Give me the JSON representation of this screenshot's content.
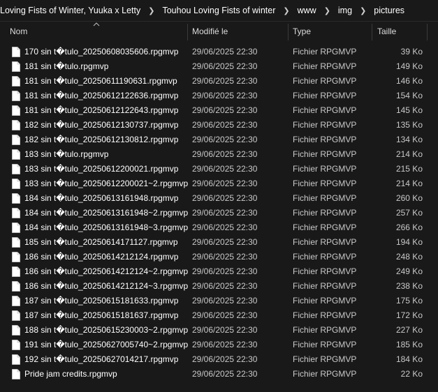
{
  "breadcrumb": [
    "Loving Fists of Winter, Yuuka x Letty",
    "Touhou Loving Fists of winter",
    "www",
    "img",
    "pictures"
  ],
  "columns": {
    "name": "Nom",
    "modified": "Modifié le",
    "type": "Type",
    "size": "Taille"
  },
  "files": [
    {
      "name": "170 sin t�tulo_20250608035606.rpgmvp",
      "modified": "29/06/2025 22:30",
      "type": "Fichier RPGMVP",
      "size": "39 Ko"
    },
    {
      "name": "181 sin t�tulo.rpgmvp",
      "modified": "29/06/2025 22:30",
      "type": "Fichier RPGMVP",
      "size": "149 Ko"
    },
    {
      "name": "181 sin t�tulo_20250611190631.rpgmvp",
      "modified": "29/06/2025 22:30",
      "type": "Fichier RPGMVP",
      "size": "146 Ko"
    },
    {
      "name": "181 sin t�tulo_20250612122636.rpgmvp",
      "modified": "29/06/2025 22:30",
      "type": "Fichier RPGMVP",
      "size": "154 Ko"
    },
    {
      "name": "181 sin t�tulo_20250612122643.rpgmvp",
      "modified": "29/06/2025 22:30",
      "type": "Fichier RPGMVP",
      "size": "145 Ko"
    },
    {
      "name": "182 sin t�tulo_20250612130737.rpgmvp",
      "modified": "29/06/2025 22:30",
      "type": "Fichier RPGMVP",
      "size": "135 Ko"
    },
    {
      "name": "182 sin t�tulo_20250612130812.rpgmvp",
      "modified": "29/06/2025 22:30",
      "type": "Fichier RPGMVP",
      "size": "134 Ko"
    },
    {
      "name": "183 sin t�tulo.rpgmvp",
      "modified": "29/06/2025 22:30",
      "type": "Fichier RPGMVP",
      "size": "214 Ko"
    },
    {
      "name": "183 sin t�tulo_20250612200021.rpgmvp",
      "modified": "29/06/2025 22:30",
      "type": "Fichier RPGMVP",
      "size": "215 Ko"
    },
    {
      "name": "183 sin t�tulo_20250612200021~2.rpgmvp",
      "modified": "29/06/2025 22:30",
      "type": "Fichier RPGMVP",
      "size": "214 Ko"
    },
    {
      "name": "184 sin t�tulo_20250613161948.rpgmvp",
      "modified": "29/06/2025 22:30",
      "type": "Fichier RPGMVP",
      "size": "260 Ko"
    },
    {
      "name": "184 sin t�tulo_20250613161948~2.rpgmvp",
      "modified": "29/06/2025 22:30",
      "type": "Fichier RPGMVP",
      "size": "257 Ko"
    },
    {
      "name": "184 sin t�tulo_20250613161948~3.rpgmvp",
      "modified": "29/06/2025 22:30",
      "type": "Fichier RPGMVP",
      "size": "266 Ko"
    },
    {
      "name": "185 sin t�tulo_20250614171127.rpgmvp",
      "modified": "29/06/2025 22:30",
      "type": "Fichier RPGMVP",
      "size": "194 Ko"
    },
    {
      "name": "186 sin t�tulo_20250614212124.rpgmvp",
      "modified": "29/06/2025 22:30",
      "type": "Fichier RPGMVP",
      "size": "248 Ko"
    },
    {
      "name": "186 sin t�tulo_20250614212124~2.rpgmvp",
      "modified": "29/06/2025 22:30",
      "type": "Fichier RPGMVP",
      "size": "249 Ko"
    },
    {
      "name": "186 sin t�tulo_20250614212124~3.rpgmvp",
      "modified": "29/06/2025 22:30",
      "type": "Fichier RPGMVP",
      "size": "238 Ko"
    },
    {
      "name": "187 sin t�tulo_20250615181633.rpgmvp",
      "modified": "29/06/2025 22:30",
      "type": "Fichier RPGMVP",
      "size": "175 Ko"
    },
    {
      "name": "187 sin t�tulo_20250615181637.rpgmvp",
      "modified": "29/06/2025 22:30",
      "type": "Fichier RPGMVP",
      "size": "172 Ko"
    },
    {
      "name": "188 sin t�tulo_20250615230003~2.rpgmvp",
      "modified": "29/06/2025 22:30",
      "type": "Fichier RPGMVP",
      "size": "227 Ko"
    },
    {
      "name": "191 sin t�tulo_20250627005740~2.rpgmvp",
      "modified": "29/06/2025 22:30",
      "type": "Fichier RPGMVP",
      "size": "185 Ko"
    },
    {
      "name": "192 sin t�tulo_20250627014217.rpgmvp",
      "modified": "29/06/2025 22:30",
      "type": "Fichier RPGMVP",
      "size": "184 Ko"
    },
    {
      "name": "Pride jam credits.rpgmvp",
      "modified": "29/06/2025 22:30",
      "type": "Fichier RPGMVP",
      "size": "22 Ko"
    }
  ],
  "icons": {
    "file": "file-icon",
    "separator": "chevron-right-icon",
    "sort": "sort-ascending-icon"
  },
  "colors": {
    "background": "#191919",
    "text": "#ffffff",
    "secondary_text": "#c9c9c9"
  }
}
